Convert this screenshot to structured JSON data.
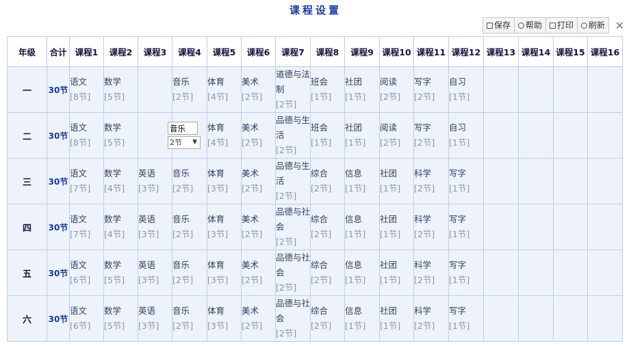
{
  "title": "课程设置",
  "toolbar": {
    "save": "保存",
    "help": "帮助",
    "print": "打印",
    "refresh": "刷新",
    "tools_icon": "tools-icon"
  },
  "table": {
    "headers": [
      "年级",
      "合计",
      "课程1",
      "课程2",
      "课程3",
      "课程4",
      "课程5",
      "课程6",
      "课程7",
      "课程8",
      "课程9",
      "课程10",
      "课程11",
      "课程12",
      "课程13",
      "课程14",
      "课程15",
      "课程16"
    ],
    "rows": [
      {
        "grade": "一",
        "total": "30节",
        "courses": [
          {
            "n": "语文",
            "c": "[8节]"
          },
          {
            "n": "数学",
            "c": "[5节]"
          },
          null,
          {
            "n": "音乐",
            "c": "[2节]"
          },
          {
            "n": "体育",
            "c": "[4节]"
          },
          {
            "n": "美术",
            "c": "[2节]"
          },
          {
            "n": "道德与法制",
            "c": "[2节]"
          },
          {
            "n": "班会",
            "c": "[1节]"
          },
          {
            "n": "社团",
            "c": "[1节]"
          },
          {
            "n": "阅读",
            "c": "[2节]"
          },
          {
            "n": "写字",
            "c": "[2节]"
          },
          {
            "n": "自习",
            "c": "[1节]"
          },
          null,
          null,
          null,
          null
        ]
      },
      {
        "grade": "二",
        "total": "30节",
        "courses": [
          {
            "n": "语文",
            "c": "[8节]"
          },
          {
            "n": "数学",
            "c": "[5节]"
          },
          null,
          {
            "edit": true,
            "n": "音乐",
            "c": "2节"
          },
          {
            "n": "体育",
            "c": "[4节]"
          },
          {
            "n": "美术",
            "c": "[2节]"
          },
          {
            "n": "品德与生活",
            "c": "[2节]"
          },
          {
            "n": "班会",
            "c": "[1节]"
          },
          {
            "n": "社团",
            "c": "[1节]"
          },
          {
            "n": "阅读",
            "c": "[2节]"
          },
          {
            "n": "写字",
            "c": "[2节]"
          },
          {
            "n": "自习",
            "c": "[1节]"
          },
          null,
          null,
          null,
          null
        ]
      },
      {
        "grade": "三",
        "total": "30节",
        "courses": [
          {
            "n": "语文",
            "c": "[7节]"
          },
          {
            "n": "数学",
            "c": "[4节]"
          },
          {
            "n": "英语",
            "c": "[3节]"
          },
          {
            "n": "音乐",
            "c": "[2节]"
          },
          {
            "n": "体育",
            "c": "[3节]"
          },
          {
            "n": "美术",
            "c": "[2节]"
          },
          {
            "n": "品德与生活",
            "c": "[2节]"
          },
          {
            "n": "综合",
            "c": "[2节]"
          },
          {
            "n": "信息",
            "c": "[1节]"
          },
          {
            "n": "社团",
            "c": "[1节]"
          },
          {
            "n": "科学",
            "c": "[2节]"
          },
          {
            "n": "写字",
            "c": "[1节]"
          },
          null,
          null,
          null,
          null
        ]
      },
      {
        "grade": "四",
        "total": "30节",
        "courses": [
          {
            "n": "语文",
            "c": "[7节]"
          },
          {
            "n": "数学",
            "c": "[4节]"
          },
          {
            "n": "英语",
            "c": "[3节]"
          },
          {
            "n": "音乐",
            "c": "[2节]"
          },
          {
            "n": "体育",
            "c": "[3节]"
          },
          {
            "n": "美术",
            "c": "[2节]"
          },
          {
            "n": "品德与社会",
            "c": "[2节]"
          },
          {
            "n": "综合",
            "c": "[2节]"
          },
          {
            "n": "信息",
            "c": "[1节]"
          },
          {
            "n": "社团",
            "c": "[1节]"
          },
          {
            "n": "科学",
            "c": "[2节]"
          },
          {
            "n": "写字",
            "c": "[1节]"
          },
          null,
          null,
          null,
          null
        ]
      },
      {
        "grade": "五",
        "total": "30节",
        "courses": [
          {
            "n": "语文",
            "c": "[6节]"
          },
          {
            "n": "数学",
            "c": "[5节]"
          },
          {
            "n": "英语",
            "c": "[3节]"
          },
          {
            "n": "音乐",
            "c": "[2节]"
          },
          {
            "n": "体育",
            "c": "[3节]"
          },
          {
            "n": "美术",
            "c": "[2节]"
          },
          {
            "n": "品德与社会",
            "c": "[2节]"
          },
          {
            "n": "综合",
            "c": "[2节]"
          },
          {
            "n": "信息",
            "c": "[1节]"
          },
          {
            "n": "社团",
            "c": "[1节]"
          },
          {
            "n": "科学",
            "c": "[2节]"
          },
          {
            "n": "写字",
            "c": "[1节]"
          },
          null,
          null,
          null,
          null
        ]
      },
      {
        "grade": "六",
        "total": "30节",
        "courses": [
          {
            "n": "语文",
            "c": "[6节]"
          },
          {
            "n": "数学",
            "c": "[5节]"
          },
          {
            "n": "英语",
            "c": "[3节]"
          },
          {
            "n": "音乐",
            "c": "[2节]"
          },
          {
            "n": "体育",
            "c": "[3节]"
          },
          {
            "n": "美术",
            "c": "[2节]"
          },
          {
            "n": "品德与社会",
            "c": "[2节]"
          },
          {
            "n": "综合",
            "c": "[2节]"
          },
          {
            "n": "信息",
            "c": "[1节]"
          },
          {
            "n": "社团",
            "c": "[1节]"
          },
          {
            "n": "科学",
            "c": "[2节]"
          },
          {
            "n": "写字",
            "c": "[1节]"
          },
          null,
          null,
          null,
          null
        ]
      }
    ]
  },
  "colors": {
    "title": "#1a3a9c",
    "cell_bg": "#eef3fb",
    "border": "#bfcde6"
  }
}
